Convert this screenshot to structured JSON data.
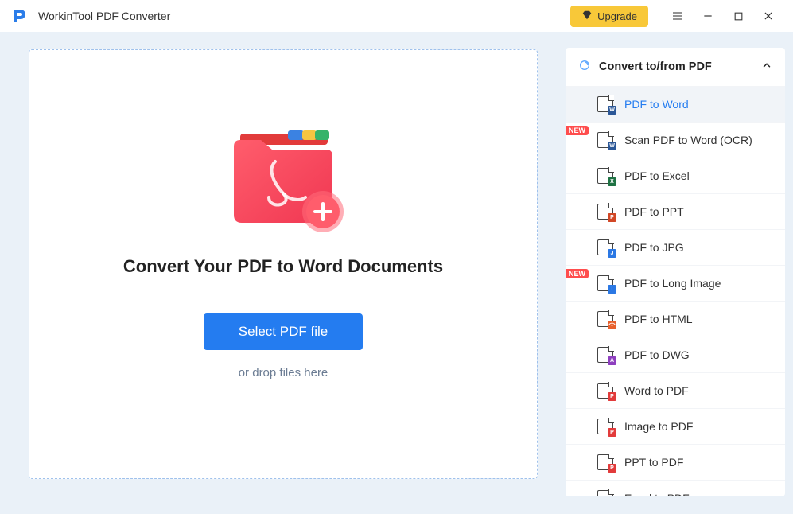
{
  "app": {
    "title": "WorkinTool PDF Converter"
  },
  "titlebar": {
    "upgrade": "Upgrade"
  },
  "main": {
    "headline": "Convert Your PDF to Word Documents",
    "select_btn": "Select PDF file",
    "drop_hint": "or drop files here"
  },
  "sidebar": {
    "section_title": "Convert to/from PDF",
    "items": [
      {
        "label": "PDF to Word",
        "badge": "W",
        "color": "b-word",
        "new": false,
        "active": true
      },
      {
        "label": "Scan PDF to Word (OCR)",
        "badge": "W",
        "color": "b-word",
        "new": true,
        "active": false
      },
      {
        "label": "PDF to Excel",
        "badge": "X",
        "color": "b-excel",
        "new": false,
        "active": false
      },
      {
        "label": "PDF to PPT",
        "badge": "P",
        "color": "b-ppt",
        "new": false,
        "active": false
      },
      {
        "label": "PDF to JPG",
        "badge": "J",
        "color": "b-jpg",
        "new": false,
        "active": false
      },
      {
        "label": "PDF to Long Image",
        "badge": "I",
        "color": "b-jpg",
        "new": true,
        "active": false
      },
      {
        "label": "PDF to HTML",
        "badge": "<>",
        "color": "b-html",
        "new": false,
        "active": false
      },
      {
        "label": "PDF to DWG",
        "badge": "A",
        "color": "b-dwg",
        "new": false,
        "active": false
      },
      {
        "label": "Word to PDF",
        "badge": "P",
        "color": "b-pdf",
        "new": false,
        "active": false
      },
      {
        "label": "Image to PDF",
        "badge": "P",
        "color": "b-pdf",
        "new": false,
        "active": false
      },
      {
        "label": "PPT to PDF",
        "badge": "P",
        "color": "b-pdf",
        "new": false,
        "active": false
      },
      {
        "label": "Excel to PDF",
        "badge": "P",
        "color": "b-pdf",
        "new": false,
        "active": false
      }
    ],
    "new_tag": "NEW"
  }
}
